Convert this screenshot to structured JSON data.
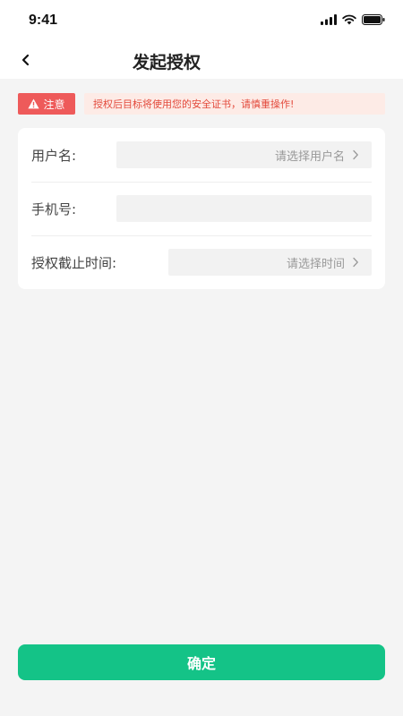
{
  "status_bar": {
    "time": "9:41"
  },
  "nav": {
    "title": "发起授权"
  },
  "notice": {
    "badge_label": "注意",
    "message": "授权后目标将使用您的安全证书，请慎重操作!"
  },
  "form": {
    "username": {
      "label": "用户名:",
      "placeholder": "请选择用户名"
    },
    "phone": {
      "label": "手机号:",
      "value": ""
    },
    "deadline": {
      "label": "授权截止时间:",
      "placeholder": "请选择时间"
    }
  },
  "confirm_label": "确定",
  "colors": {
    "accent": "#14c387",
    "warning_badge": "#ee5a5a",
    "warning_text": "#e3493b",
    "warning_bg": "#fdebe6"
  }
}
